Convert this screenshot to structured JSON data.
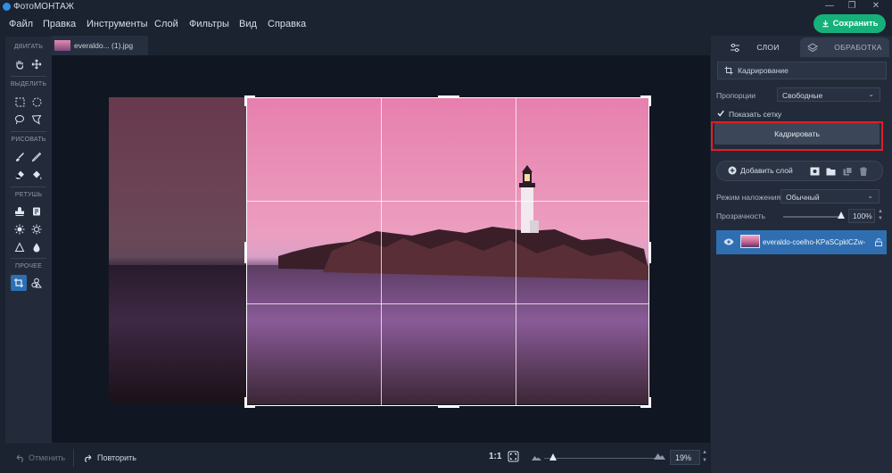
{
  "app": {
    "title": "ФотоМОНТАЖ"
  },
  "window_controls": {
    "minimize": "—",
    "maximize": "❐",
    "close": "✕"
  },
  "menu": [
    "Файл",
    "Правка",
    "Инструменты",
    "Слой",
    "Фильтры",
    "Вид",
    "Справка"
  ],
  "save_button": {
    "label": "Сохранить",
    "color": "#16b07a"
  },
  "toolbar": {
    "groups": [
      {
        "label": "ДВИГАТЬ",
        "tools": [
          "hand-icon",
          "move-icon"
        ]
      },
      {
        "label": "ВЫДЕЛИТЬ",
        "tools": [
          "rect-select-icon",
          "ellipse-select-icon",
          "lasso-icon",
          "polygon-lasso-icon"
        ]
      },
      {
        "label": "РИСОВАТЬ",
        "tools": [
          "brush-icon",
          "pencil-icon",
          "eraser-icon",
          "fill-icon"
        ]
      },
      {
        "label": "РЕТУШЬ",
        "tools": [
          "stamp-icon",
          "patch-icon",
          "brightness-icon",
          "exposure-icon",
          "sharpen-icon",
          "blur-icon"
        ]
      },
      {
        "label": "ПРОЧЕЕ",
        "tools": [
          "crop-icon",
          "shapes-icon"
        ]
      }
    ]
  },
  "document_tab": {
    "name": "everaldo... (1).jpg"
  },
  "bottom": {
    "undo": "Отменить",
    "redo": "Повторить",
    "fit": "1:1",
    "zoom": "19%",
    "zoom_level": 0.05
  },
  "panel": {
    "tabs": [
      {
        "label": "СЛОИ",
        "active": true
      },
      {
        "label": "ОБРАБОТКА",
        "active": false
      }
    ],
    "crop_title": "Кадрирование",
    "proportions_label": "Пропорции",
    "proportions_value": "Свободные",
    "show_grid_label": "Показать сетку",
    "show_grid_checked": true,
    "crop_button": "Кадрировать",
    "add_layer": "Добавить слой",
    "blend_label": "Режим наложения:",
    "blend_value": "Обычный",
    "opacity_label": "Прозрачность",
    "opacity_value": "100%",
    "opacity_level": 1.0,
    "layer_name": "everaldo-coelho-KPaSCpklCZw-",
    "highlight_color": "#e31e24",
    "layer_selected_color": "#2f6fb1"
  }
}
